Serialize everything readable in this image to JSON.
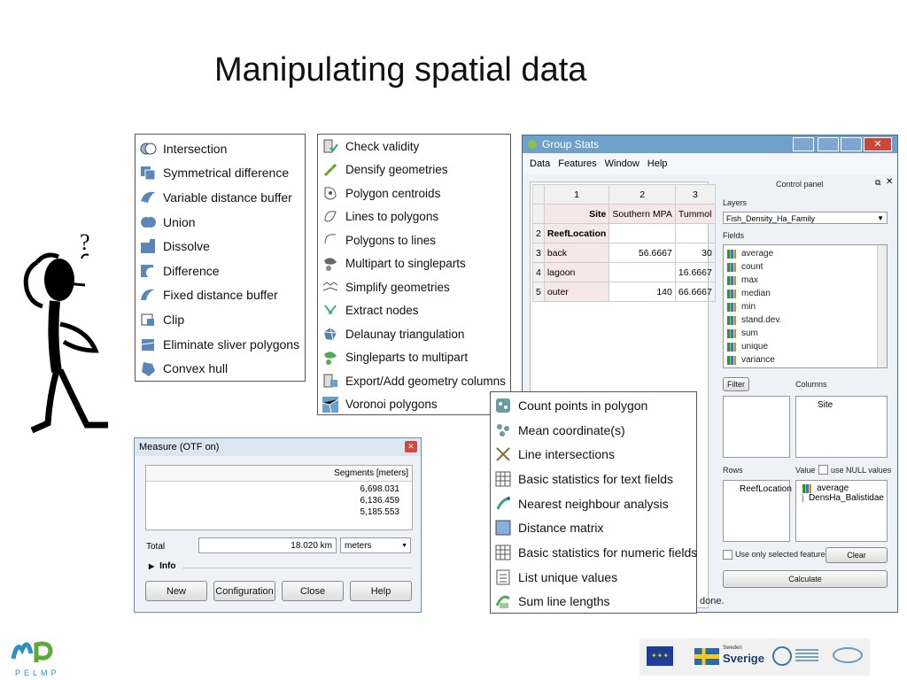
{
  "slide": {
    "title": "Manipulating spatial data"
  },
  "geoprocessing_menu": {
    "items": [
      {
        "label": "Intersection",
        "icon": "intersection-icon"
      },
      {
        "label": "Symmetrical difference",
        "icon": "symmetrical-difference-icon"
      },
      {
        "label": "Variable distance buffer",
        "icon": "variable-buffer-icon"
      },
      {
        "label": "Union",
        "icon": "union-icon"
      },
      {
        "label": "Dissolve",
        "icon": "dissolve-icon"
      },
      {
        "label": "Difference",
        "icon": "difference-icon"
      },
      {
        "label": "Fixed distance buffer",
        "icon": "fixed-buffer-icon"
      },
      {
        "label": "Clip",
        "icon": "clip-icon"
      },
      {
        "label": "Eliminate sliver polygons",
        "icon": "eliminate-sliver-icon"
      },
      {
        "label": "Convex hull",
        "icon": "convex-hull-icon"
      }
    ]
  },
  "geometry_menu": {
    "items": [
      {
        "label": "Check validity",
        "icon": "check-validity-icon"
      },
      {
        "label": "Densify geometries",
        "icon": "densify-icon"
      },
      {
        "label": "Polygon centroids",
        "icon": "centroids-icon"
      },
      {
        "label": "Lines to polygons",
        "icon": "lines-to-polygons-icon"
      },
      {
        "label": "Polygons to lines",
        "icon": "polygons-to-lines-icon"
      },
      {
        "label": "Multipart to singleparts",
        "icon": "multipart-icon"
      },
      {
        "label": "Simplify geometries",
        "icon": "simplify-icon"
      },
      {
        "label": "Extract nodes",
        "icon": "extract-nodes-icon"
      },
      {
        "label": "Delaunay triangulation",
        "icon": "delaunay-icon"
      },
      {
        "label": "Singleparts to multipart",
        "icon": "singleparts-icon"
      },
      {
        "label": "Export/Add geometry columns",
        "icon": "export-columns-icon"
      },
      {
        "label": "Voronoi polygons",
        "icon": "voronoi-icon"
      }
    ]
  },
  "analysis_menu": {
    "items": [
      {
        "label": "Count points in polygon",
        "icon": "count-points-icon"
      },
      {
        "label": "Mean coordinate(s)",
        "icon": "mean-coordinate-icon"
      },
      {
        "label": "Line intersections",
        "icon": "line-intersections-icon"
      },
      {
        "label": "Basic statistics for text fields",
        "icon": "table-stats-icon"
      },
      {
        "label": "Nearest neighbour analysis",
        "icon": "nearest-neighbour-icon"
      },
      {
        "label": "Distance matrix",
        "icon": "distance-matrix-icon"
      },
      {
        "label": "Basic statistics for numeric fields",
        "icon": "table-stats-icon"
      },
      {
        "label": "List unique values",
        "icon": "list-unique-icon"
      },
      {
        "label": "Sum line lengths",
        "icon": "sum-lengths-icon"
      }
    ],
    "status_fragment": "done."
  },
  "group_stats": {
    "window_title": "Group Stats",
    "menu": [
      "Data",
      "Features",
      "Window",
      "Help"
    ],
    "table": {
      "col_headers": [
        "1",
        "2",
        "3"
      ],
      "rows": [
        {
          "num": "",
          "c1": "Site",
          "c2": "Southern MPA",
          "c3": "Tummol"
        },
        {
          "num": "2",
          "c1": "ReefLocation",
          "c2": "",
          "c3": ""
        },
        {
          "num": "3",
          "c1": "back",
          "c2": "56.6667",
          "c3": "30"
        },
        {
          "num": "4",
          "c1": "lagoon",
          "c2": "",
          "c3": "16.6667"
        },
        {
          "num": "5",
          "c1": "outer",
          "c2": "140",
          "c3": "66.6667"
        }
      ]
    },
    "control_panel": {
      "title": "Control panel",
      "layers_label": "Layers",
      "layer_value": "Fish_Density_Ha_Family",
      "fields_label": "Fields",
      "fields": [
        "average",
        "count",
        "max",
        "median",
        "min",
        "stand.dev.",
        "sum",
        "unique",
        "variance"
      ],
      "filter_button": "Filter",
      "columns_label": "Columns",
      "columns_items": [
        "Site"
      ],
      "rows_label": "Rows",
      "value_label": "Value",
      "null_label": "use NULL values",
      "rows_items": [
        "ReefLocation"
      ],
      "value_items": [
        "average",
        "DensHa_Balistidae"
      ],
      "selected_only_label": "Use only selected features",
      "clear_button": "Clear",
      "calculate_button": "Calculate"
    }
  },
  "measure": {
    "window_title": "Measure (OTF on)",
    "header": "Segments [meters]",
    "segments": [
      "6,698.031",
      "6,136.459",
      "5,185.553"
    ],
    "total_label": "Total",
    "total_value": "18.020 km",
    "unit": "meters",
    "info_label": "Info",
    "buttons": [
      "New",
      "Configuration",
      "Close",
      "Help"
    ]
  },
  "footer": {
    "logo_text": "PELMP",
    "sverige_label": "Sverige",
    "sweden_label": "Sweden"
  }
}
